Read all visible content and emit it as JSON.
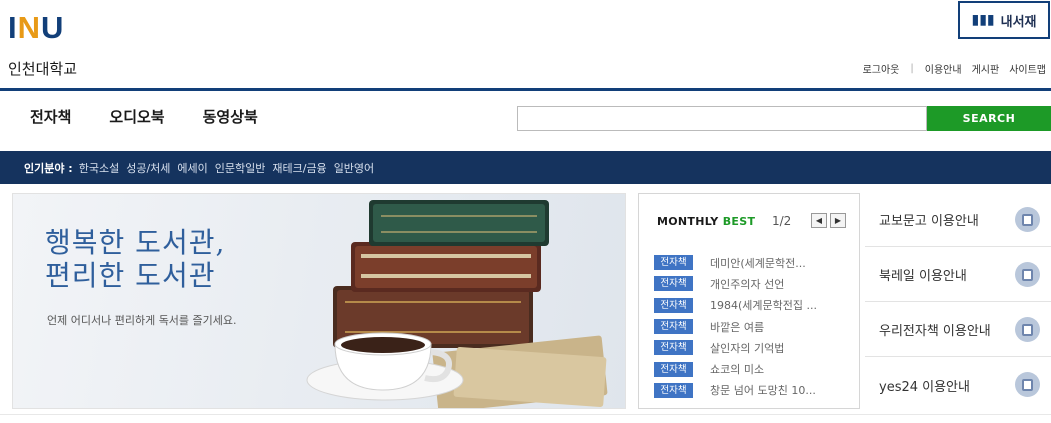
{
  "header": {
    "logo_parts": [
      "I",
      "N",
      "U"
    ],
    "logo_sub": "인천대학교",
    "my_books_label": "내서재",
    "util_links": [
      "로그아웃",
      "이용안내",
      "게시판",
      "사이트맵"
    ]
  },
  "nav": {
    "items": [
      "전자책",
      "오디오북",
      "동영상북"
    ],
    "search_value": "",
    "search_button": "SEARCH"
  },
  "popular": {
    "label": "인기분야 :",
    "items": [
      "한국소설",
      "성공/처세",
      "에세이",
      "인문학일반",
      "재테크/금융",
      "일반영어"
    ]
  },
  "banner": {
    "title_line1": "행복한 도서관,",
    "title_line2": "편리한 도서관",
    "subtitle": "언제 어디서나 편리하게 독서를 즐기세요."
  },
  "monthly_best": {
    "heading_part1": "MONTHLY",
    "heading_part2": "BEST",
    "page": "1/2",
    "items": [
      {
        "tag": "전자책",
        "title": "데미안(세계문학전..."
      },
      {
        "tag": "전자책",
        "title": "개인주의자 선언"
      },
      {
        "tag": "전자책",
        "title": "1984(세계문학전집 ..."
      },
      {
        "tag": "전자책",
        "title": "바깥은 여름"
      },
      {
        "tag": "전자책",
        "title": "살인자의 기억법"
      },
      {
        "tag": "전자책",
        "title": "쇼코의 미소"
      },
      {
        "tag": "전자책",
        "title": "창문 넘어 도망친 10..."
      }
    ]
  },
  "guides": [
    {
      "label": "교보문고 이용안내",
      "icon": "book-icon"
    },
    {
      "label": "북레일 이용안내",
      "icon": "book-icon"
    },
    {
      "label": "우리전자책 이용안내",
      "icon": "book-icon"
    },
    {
      "label": "yes24 이용안내",
      "icon": "book-icon"
    }
  ],
  "colors": {
    "brand_navy": "#123f79",
    "accent_orange": "#e89a17",
    "search_green": "#1d9a27",
    "popular_bar": "#15335e",
    "tag_blue": "#3f74c4"
  }
}
